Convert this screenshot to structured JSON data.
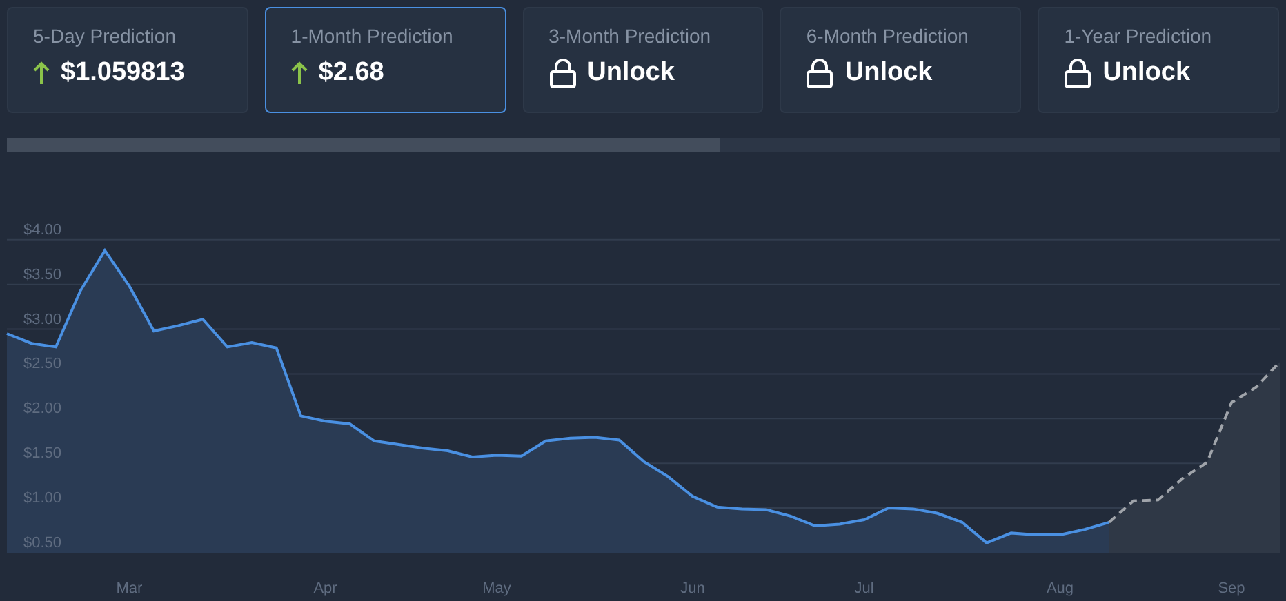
{
  "cards": [
    {
      "label": "5-Day Prediction",
      "kind": "rising",
      "value": "$1.059813",
      "selected": false
    },
    {
      "label": "1-Month Prediction",
      "kind": "rising",
      "value": "$2.68",
      "selected": true
    },
    {
      "label": "3-Month Prediction",
      "kind": "locked",
      "value": "Unlock",
      "selected": false
    },
    {
      "label": "6-Month Prediction",
      "kind": "locked",
      "value": "Unlock",
      "selected": false
    },
    {
      "label": "1-Year Prediction",
      "kind": "locked",
      "value": "Unlock",
      "selected": false
    }
  ],
  "chart": {
    "chart_data": {
      "type": "area",
      "grid": true,
      "categories": [
        null,
        null,
        null,
        null,
        null,
        "Mar",
        null,
        null,
        null,
        null,
        null,
        null,
        null,
        "Apr",
        null,
        null,
        null,
        null,
        null,
        null,
        "May",
        null,
        null,
        null,
        null,
        null,
        null,
        null,
        "Jun",
        null,
        null,
        null,
        null,
        null,
        null,
        "Jul",
        null,
        null,
        null,
        null,
        null,
        null,
        null,
        "Aug",
        null,
        null,
        null,
        null,
        null,
        null,
        "Sep",
        null,
        null
      ],
      "series": [
        {
          "color": "#4a90e2",
          "line_style": "solid",
          "values": [
            2.95,
            2.84,
            2.8,
            3.43,
            3.88,
            3.48,
            2.98,
            3.04,
            3.11,
            2.8,
            2.85,
            2.79,
            2.03,
            1.97,
            1.94,
            1.75,
            1.71,
            1.67,
            1.64,
            1.57,
            1.59,
            1.58,
            1.75,
            1.78,
            1.79,
            1.76,
            1.52,
            1.35,
            1.13,
            1.01,
            0.99,
            0.98,
            0.91,
            0.8,
            0.82,
            0.87,
            1.0,
            0.99,
            0.94,
            0.84,
            0.61,
            0.72,
            0.7,
            0.7,
            0.76,
            0.84,
            null,
            null,
            null,
            null,
            null,
            null,
            null
          ]
        },
        {
          "color": "#a0a4aa",
          "line_style": "dashed",
          "values": [
            null,
            null,
            null,
            null,
            null,
            null,
            null,
            null,
            null,
            null,
            null,
            null,
            null,
            null,
            null,
            null,
            null,
            null,
            null,
            null,
            null,
            null,
            null,
            null,
            null,
            null,
            null,
            null,
            null,
            null,
            null,
            null,
            null,
            null,
            null,
            null,
            null,
            null,
            null,
            null,
            null,
            null,
            null,
            null,
            null,
            0.84,
            1.08,
            1.09,
            1.33,
            1.51,
            2.18,
            2.35,
            2.64
          ]
        }
      ],
      "ylim": [
        -0.04,
        6.68
      ],
      "yticks": [
        {
          "value": 0.5,
          "label": "$0.50"
        },
        {
          "value": 1,
          "label": "$1.00"
        },
        {
          "value": 1.5,
          "label": "$1.50"
        },
        {
          "value": 2,
          "label": "$2.00"
        },
        {
          "value": 2.5,
          "label": "$2.50"
        },
        {
          "value": 3,
          "label": "$3.00"
        },
        {
          "value": 3.5,
          "label": "$3.50"
        },
        {
          "value": 4,
          "label": "$4.00"
        }
      ]
    }
  }
}
